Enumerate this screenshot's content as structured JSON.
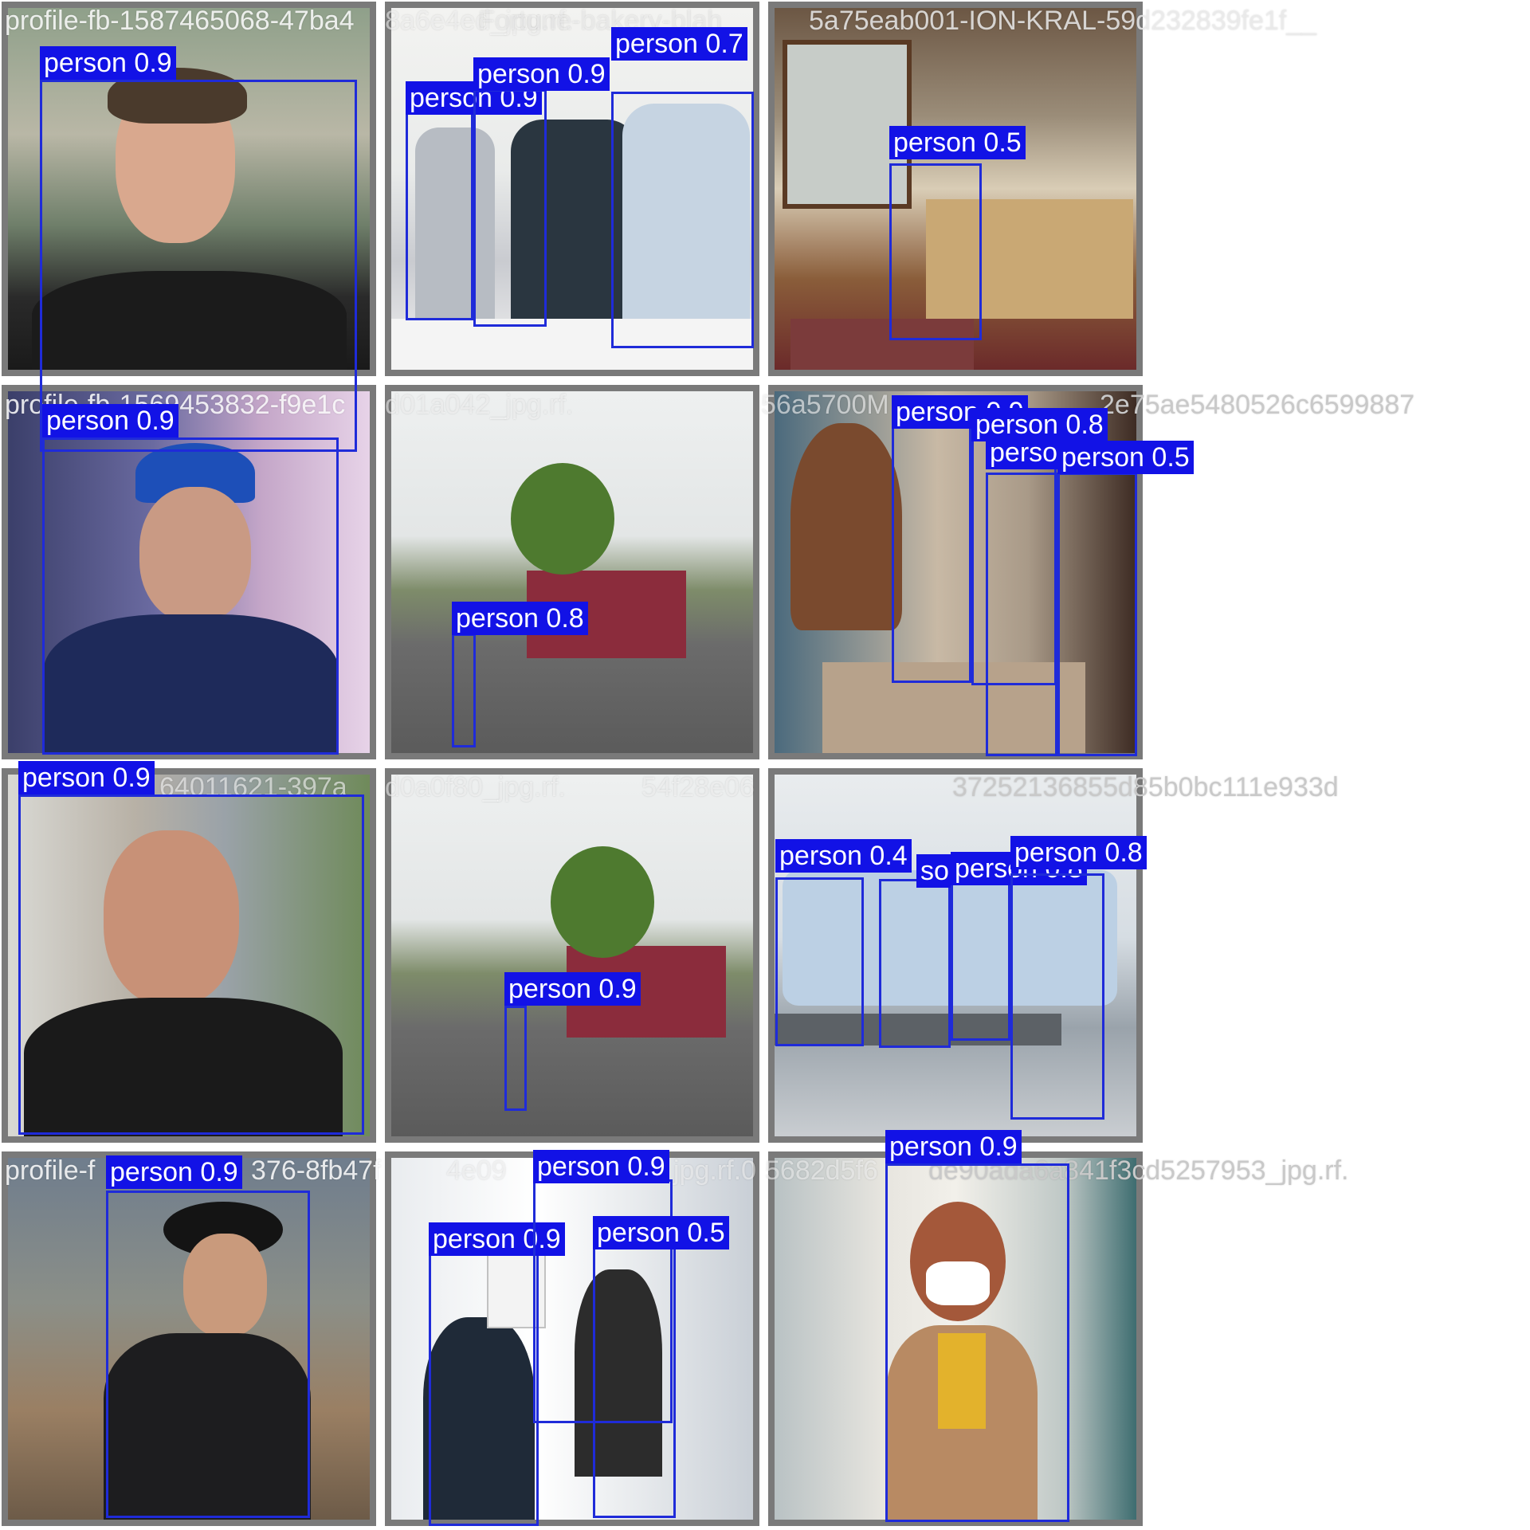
{
  "colors": {
    "box_border": "#1f2bd9",
    "label_bg": "#1212e6",
    "label_text": "#ffffff",
    "tile_frame": "#7a7a7a"
  },
  "filenames": [
    "profile-fb-1587465068-47ba4",
    "8a6e4ed_jpg.rf.",
    "Fortune-bakery-blah",
    "5a75eab001-ION-KRAL-59d232839fe1f__",
    "profile-fb-1569453832-f9e1c",
    "d01a042_jpg.rf.",
    "56a5700M",
    "2e75ae5480526c6599887",
    "64011621-397a",
    "d0a0f80_jpg.rf.",
    "54f28e06",
    "37252136855d85b0bc111e933d",
    "profile-f",
    "376-8fb47f",
    "4e09",
    "jpg.rf.0",
    "5682d5f6",
    "de90ada6a841f3cd5257953_jpg.rf."
  ],
  "detections": [
    {
      "tile": 0,
      "label": "person 0.9"
    },
    {
      "tile": 1,
      "label": "person 0.9"
    },
    {
      "tile": 1,
      "label": "person 0.9"
    },
    {
      "tile": 1,
      "label": "person 0.7"
    },
    {
      "tile": 2,
      "label": "person 0.5"
    },
    {
      "tile": 3,
      "label": "person 0.9"
    },
    {
      "tile": 4,
      "label": "person 0.8"
    },
    {
      "tile": 5,
      "label": "person 0.9"
    },
    {
      "tile": 5,
      "label": "person 0.8"
    },
    {
      "tile": 5,
      "label": "perso"
    },
    {
      "tile": 5,
      "label": "person 0.5"
    },
    {
      "tile": 6,
      "label": "person 0.9"
    },
    {
      "tile": 7,
      "label": "person 0.9"
    },
    {
      "tile": 8,
      "label": "person 0.4"
    },
    {
      "tile": 8,
      "label": "so"
    },
    {
      "tile": 8,
      "label": "person 0.8"
    },
    {
      "tile": 8,
      "label": "person 0.8"
    },
    {
      "tile": 9,
      "label": "person 0.9"
    },
    {
      "tile": 10,
      "label": "person 0.9"
    },
    {
      "tile": 10,
      "label": "person 0.9"
    },
    {
      "tile": 10,
      "label": "person 0.5"
    },
    {
      "tile": 11,
      "label": "person 0.9"
    }
  ]
}
